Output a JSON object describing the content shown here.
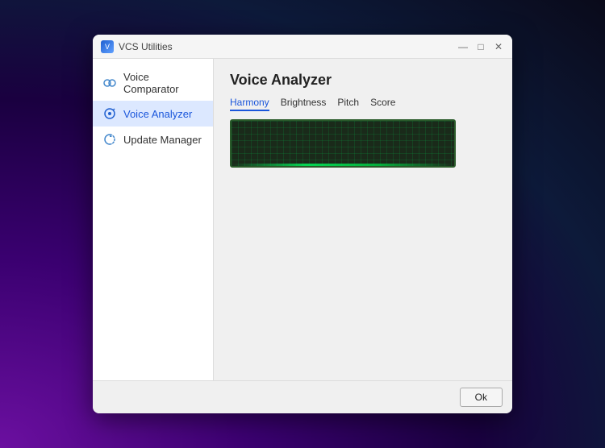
{
  "window": {
    "title": "VCS Utilities",
    "app_icon": "V"
  },
  "titlebar": {
    "minimize_label": "—",
    "maximize_label": "□",
    "close_label": "✕"
  },
  "sidebar": {
    "items": [
      {
        "id": "voice-comparator",
        "label": "Voice Comparator",
        "active": false
      },
      {
        "id": "voice-analyzer",
        "label": "Voice Analyzer",
        "active": true
      },
      {
        "id": "update-manager",
        "label": "Update Manager",
        "active": false
      }
    ]
  },
  "main": {
    "title": "Voice Analyzer",
    "tabs": [
      {
        "id": "harmony",
        "label": "Harmony",
        "active": true
      },
      {
        "id": "brightness",
        "label": "Brightness",
        "active": false
      },
      {
        "id": "pitch",
        "label": "Pitch",
        "active": false
      },
      {
        "id": "score",
        "label": "Score",
        "active": false
      }
    ]
  },
  "footer": {
    "ok_label": "Ok"
  }
}
